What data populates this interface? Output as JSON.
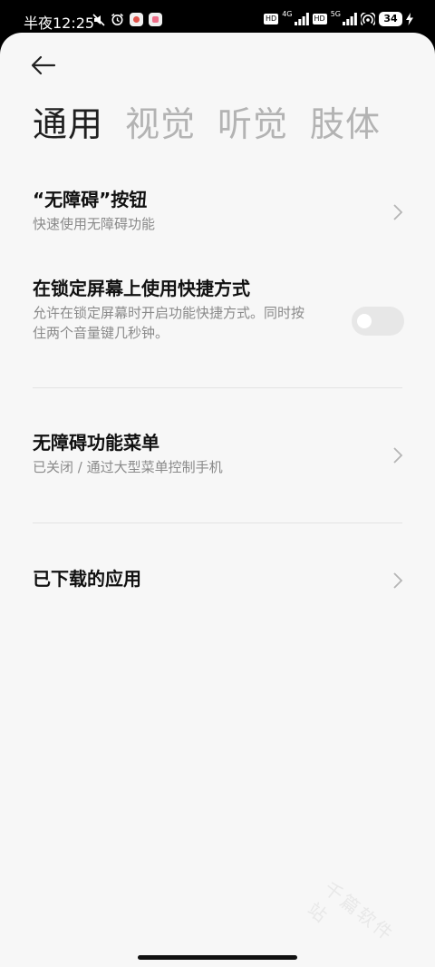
{
  "status_bar": {
    "time": "半夜12:25",
    "network_1": "4G",
    "network_2": "5G",
    "hd_label": "HD",
    "battery": "34"
  },
  "tabs": [
    {
      "label": "通用",
      "active": true
    },
    {
      "label": "视觉",
      "active": false
    },
    {
      "label": "听觉",
      "active": false
    },
    {
      "label": "肢体",
      "active": false
    }
  ],
  "items": {
    "accessibility_button": {
      "title": "“无障碍”按钮",
      "subtitle": "快速使用无障碍功能"
    },
    "lock_screen_shortcut": {
      "title": "在锁定屏幕上使用快捷方式",
      "subtitle_line1": "允许在锁定屏幕时开启功能快捷方式。同时按",
      "subtitle_line2": "住两个音量键几秒钟。",
      "enabled": false
    },
    "accessibility_menu": {
      "title": "无障碍功能菜单",
      "subtitle": "已关闭 / 通过大型菜单控制手机"
    },
    "downloaded_apps": {
      "title": "已下载的应用"
    }
  },
  "watermark": "千篇软件站",
  "colors": {
    "background": "#f7f7f7",
    "title": "#111111",
    "subtitle": "#8a8a8a",
    "inactive_tab": "#b3b3b3",
    "toggle_off": "#e7e7e7"
  }
}
